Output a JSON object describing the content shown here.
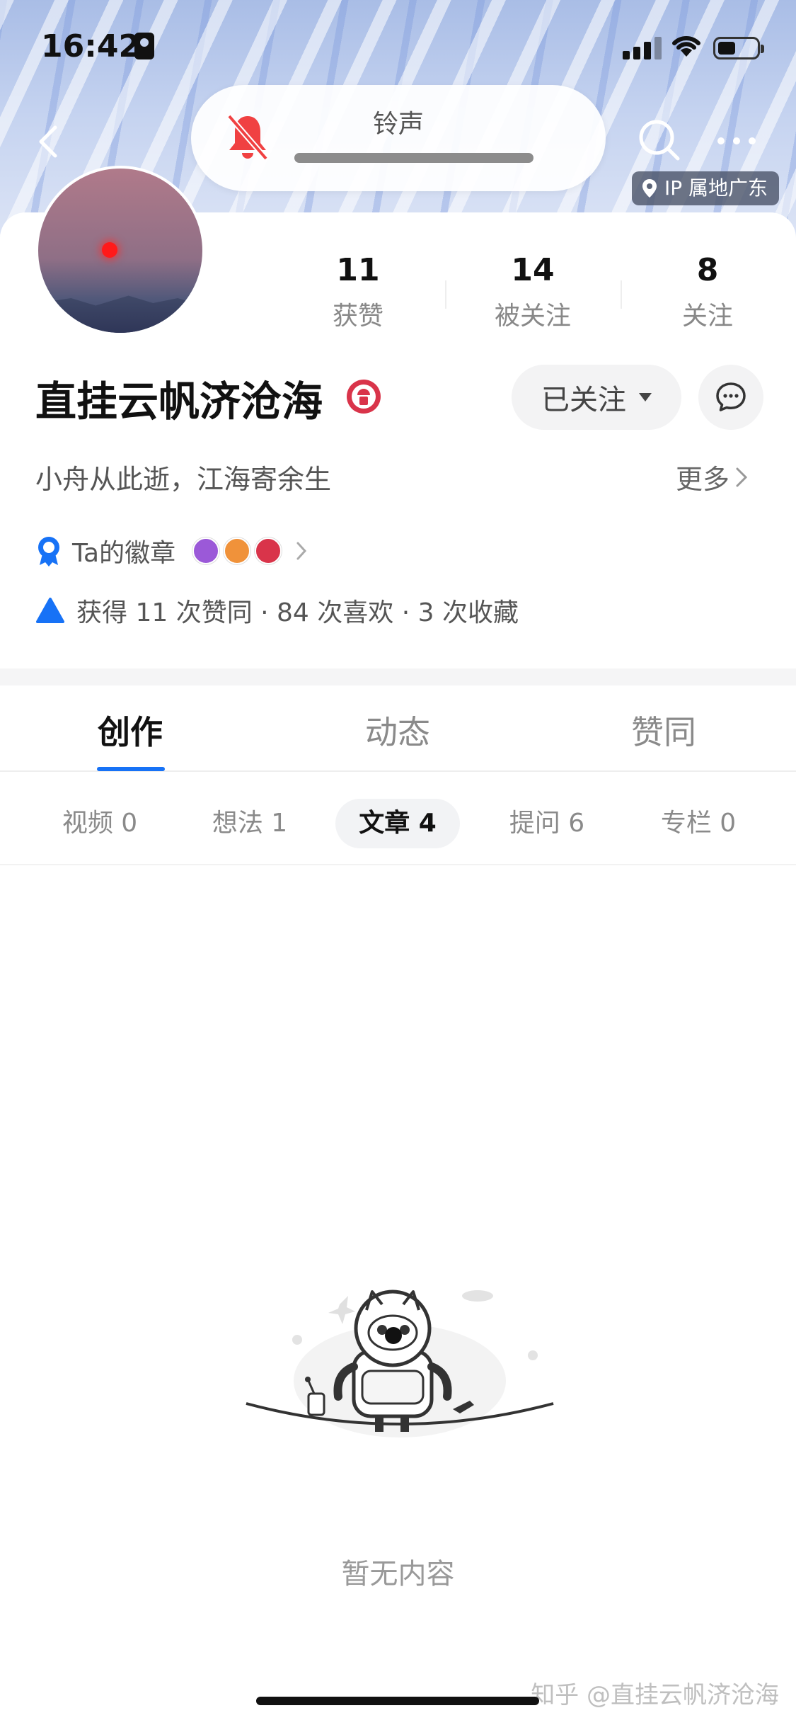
{
  "status_bar": {
    "time": "16:42"
  },
  "nav": {
    "ringtone_label": "铃声",
    "ip_location": "IP 属地广东"
  },
  "profile": {
    "name": "直挂云帆济沧海",
    "bio": "小舟从此逝，江海寄余生",
    "more_label": "更多",
    "follow_button": "已关注",
    "stats": [
      {
        "value": "11",
        "label": "获赞"
      },
      {
        "value": "14",
        "label": "被关注"
      },
      {
        "value": "8",
        "label": "关注"
      }
    ],
    "badges_label": "Ta的徽章",
    "achievements": "获得 11 次赞同 · 84 次喜欢 · 3 次收藏"
  },
  "tabs": {
    "main": [
      {
        "label": "创作",
        "active": true
      },
      {
        "label": "动态",
        "active": false
      },
      {
        "label": "赞同",
        "active": false
      }
    ],
    "sub": [
      {
        "label": "视频 0",
        "active": false
      },
      {
        "label": "想法 1",
        "active": false
      },
      {
        "label": "文章 4",
        "active": true
      },
      {
        "label": "提问 6",
        "active": false
      },
      {
        "label": "专栏 0",
        "active": false
      }
    ]
  },
  "empty_state": {
    "text": "暂无内容"
  },
  "watermark": "知乎 @直挂云帆济沧海",
  "colors": {
    "accent": "#1772f6",
    "mute_bell": "#f04142",
    "badge_ribbon": "#1772f6"
  },
  "icons": [
    "back-arrow-icon",
    "muted-bell-icon",
    "search-icon",
    "more-dots-icon",
    "location-pin-icon",
    "medal-icon",
    "chat-bubble-icon",
    "chevron-right-icon",
    "badge-ribbon-icon",
    "triangle-up-icon"
  ]
}
